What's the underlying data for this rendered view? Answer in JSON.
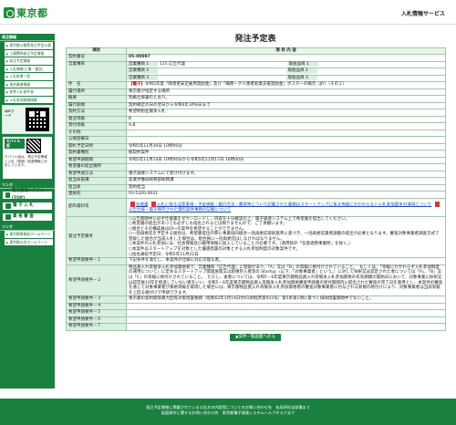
{
  "header": {
    "logo_text": "東京都",
    "site_name": "入札情報サービス"
  },
  "sidebar": {
    "section_title": "発注情報",
    "items": [
      "東京都公報等発注予定公表",
      "工事関係発注予定情報",
      "発注予定情報",
      "入札情報(工事・委託)",
      "入札結果一覧",
      "指名業者情報",
      "参考入札条件表",
      "入札参加資格情報"
    ],
    "qr_label": "QRコード",
    "mobile_title": "モバイル版",
    "mobile_text": "モバイル版は、発注予定情報と入札（発案）経過情報に対応しています。",
    "links_title": "リンク",
    "link_buttons": [
      "電子調達システム(TOP)",
      "電 子 入 札",
      "資 格 審 査"
    ],
    "extra_title": "リンク",
    "extra_links": [
      "東京都財務局ホームページ",
      "東京都公式ホームページ"
    ]
  },
  "main": {
    "title": "発注予定表",
    "col_item": "項目",
    "col_content": "項 目 内 容",
    "contract_no_label": "契約番号",
    "contract_no": "05-00097",
    "business_label": "営業種目",
    "business_rows": [
      {
        "label": "営業種目 1",
        "value": "115 広告代理",
        "sub_label": "取扱品目 1",
        "sub_value": ""
      },
      {
        "label": "営業種目 2",
        "value": "",
        "sub_label": "取扱品目 2",
        "sub_value": ""
      },
      {
        "label": "営業種目 3",
        "value": "",
        "sub_label": "取扱品目 3",
        "sub_value": ""
      }
    ],
    "name_label": "件　名",
    "name_badge": "【電子】",
    "name_value": "令和5年度「障害者安定雇用奨励金」及び「職務・ゲ人患者就業支援奨励金」ポスターの掲示（JR）（その２）",
    "rows": [
      {
        "label": "履行場所",
        "value": "東京都が指定する場所"
      },
      {
        "label": "概要",
        "value": "別紙仕様書のとおり。"
      },
      {
        "label": "履行期間",
        "value": "契約確定の日の翌日から令和6年3月8日まで"
      },
      {
        "label": "契約方法",
        "value": "希望制指名競争入札"
      },
      {
        "label": "発注等級",
        "value": "B"
      },
      {
        "label": "受付等級",
        "value": "A,B"
      },
      {
        "label": "その他",
        "value": ""
      },
      {
        "label": "公報登載日",
        "value": ""
      },
      {
        "label": "開札予定日時",
        "value": "令和5年11月30日 10時00分"
      },
      {
        "label": "契約書種別",
        "value": "紙契約案件"
      },
      {
        "label": "希望申請期間",
        "value": "令和5年11月14日 10時00分から令和5年11月17日 16時00分"
      },
      {
        "label": "希望書の提出場所",
        "value": ""
      },
      {
        "label": "希望申請方法",
        "value": "電子調達システムにて受け付けます。"
      },
      {
        "label": "担当局部課",
        "value": "産業労働局総務部総務課"
      },
      {
        "label": "担当係",
        "value": "契約担当"
      },
      {
        "label": "連絡先",
        "value": "03-5320-4631"
      }
    ],
    "docs_label": "配布資料等",
    "docs": [
      {
        "text": "仕様書",
        "link": true
      },
      {
        "text": "入札に係る注意事項・予定価格・履行方法・費用等について記載された書類はスタートアップに係る等級にかかわらない入札参加競争の運用について",
        "link": true
      },
      {
        "text": "公告仕様・電子保存された資料案件事務の記載について",
        "link": true
      }
    ],
    "notes_label": "発注予定備考",
    "notes": [
      "○公告期間中に必ず仕様書をダウンロードし、内容を十分確認の上、電子調達システム上で希望書を提出してください。",
      "○希望書の提出があっても必ずしも指名されるとは限りませんので、ご了承願います。",
      "○組合とその構成員は同一の案件を希望することができません。",
      "○一括再委託を予定する組合は、希望書提出の際に事業協同組合一括再委託取扱基準に基づき、一括再委託業者調書の提出が必要となります。審査対象事業者調査方式で登録した組合が当該入札した場合は、組合員に一括再委託はしなければなりません。",
      "○本案件の入札参加には、社会保険及び雇用保険に加入していることが必要です。（適用除外「任意適用事業所」を除く。）",
      "○本案件はスタートアップを対象とした優遇措置の対象とする入札参加制度の対象案件です。",
      "○指名通知予定日：令和5年11月22日"
    ],
    "req_rows": [
      {
        "label": "希望申請要件－１",
        "value": "下記条件を満たし、本案件の仕様に対応可能な者。"
      },
      {
        "label": "希望申請要件－２",
        "value": "物品買入れ等競争入札参加資格者で、営業種目「広告代理」に登録があり、「A」又は「B」の等級に格付けされていること。　もしくは、「等級にかかわらず入札参加制度の運用について」に定めるスタートアップ関連施策又は新規参入者等の Startup（以下、「対象事業者」という。）に対して採択又は認定された者については「A」、「B」又は「C」の等級に格付けされていること。　ただし、後者については、令和5・6年度東京都物品買入れ等競争入札参加資格の有効期間の開始日において、対象事業に採択又は認定後10年を経過していない者をいい、令和5・6年度東京都物品買入等競争入札参加資格審査申請書の受付期間内に提出された審査の完了日を基準とし、本案件の審査を通じて対象事業者が資格等級を取得した場合には、東京都物品買入れ等競争入札参加資格者の審査対象事業者に付与される新規の格付けにより、対象事業者は当該等級を上回る格付けで申請できます。"
      },
      {
        "label": "希望申請要件－３",
        "value": "東京都の契約関係暴力団等対策措置要綱（昭和62年1月14日付61財経庶第922号）第5条第1項に基づく排除措置期間中でないこと。"
      },
      {
        "label": "希望申請要件－４",
        "value": ""
      },
      {
        "label": "希望申請要件－５",
        "value": ""
      },
      {
        "label": "希望申請要件－６",
        "value": ""
      },
      {
        "label": "希望申請要件－７",
        "value": ""
      }
    ],
    "back_button": "▲案件一覧画面へ戻る"
  },
  "footer": {
    "line1": "発注予定情報に掲載されている公告文の内容等についてのお問い合わせ先　各局所担当部署まで",
    "line2": "画面操作に関するお問い合わせ先　東京都電子調達システムヘルプデスクまで"
  }
}
